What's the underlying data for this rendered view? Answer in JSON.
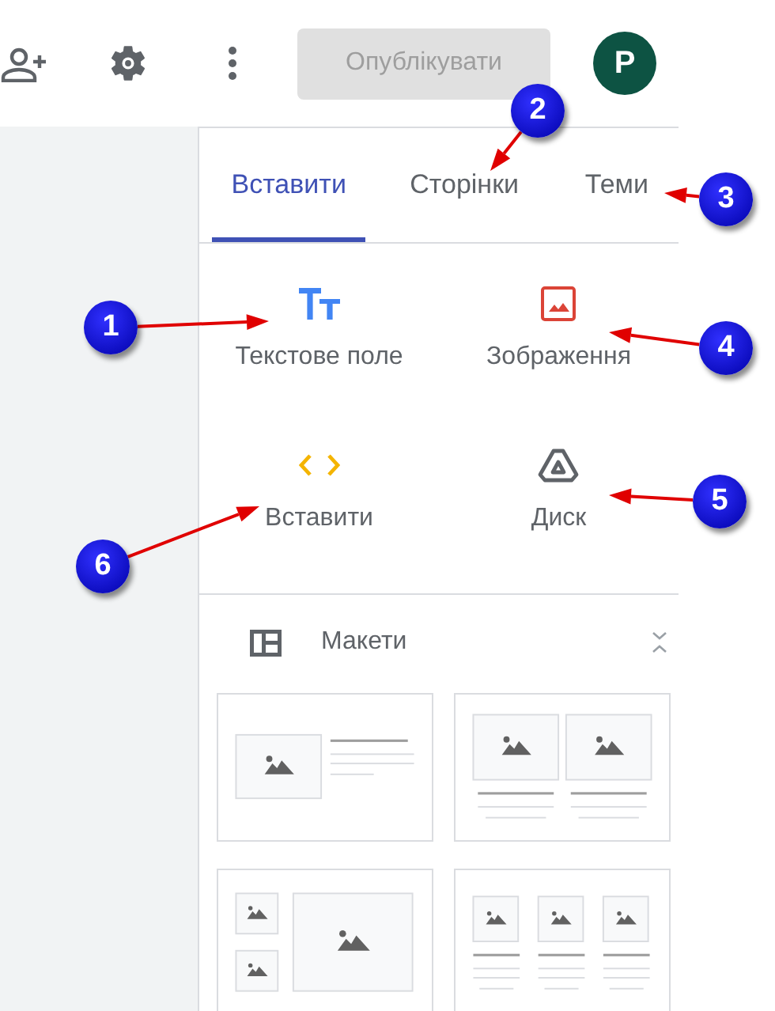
{
  "toolbar": {
    "publish_button": {
      "label": "Опублікувати",
      "disabled": true
    },
    "avatar": {
      "letter": "P"
    }
  },
  "tabs": [
    {
      "label": "Вставити",
      "selected": true
    },
    {
      "label": "Сторінки",
      "selected": false
    },
    {
      "label": "Теми",
      "selected": false
    }
  ],
  "insert_items": [
    {
      "kind": "text",
      "label": "Текстове поле"
    },
    {
      "kind": "image",
      "label": "Зображення"
    },
    {
      "kind": "embed",
      "label": "Вставити"
    },
    {
      "kind": "drive",
      "label": "Диск"
    }
  ],
  "layouts_section": {
    "title": "Макети",
    "expanded": true,
    "layouts": [
      {
        "kind": "image-text"
      },
      {
        "kind": "two-images"
      },
      {
        "kind": "image-grid"
      },
      {
        "kind": "three-images"
      }
    ]
  },
  "callouts": [
    {
      "number": "1"
    },
    {
      "number": "2"
    },
    {
      "number": "3"
    },
    {
      "number": "4"
    },
    {
      "number": "5"
    },
    {
      "number": "6"
    }
  ]
}
